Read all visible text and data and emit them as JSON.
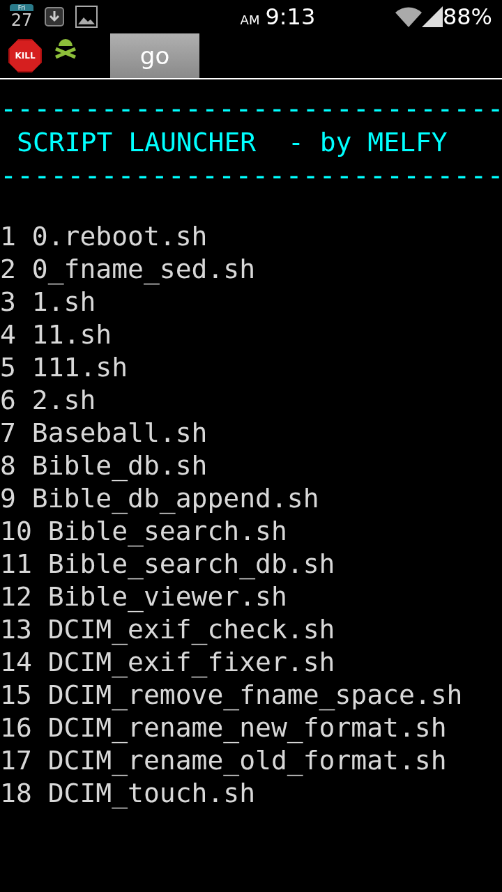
{
  "status_bar": {
    "calendar_day": "Fri",
    "calendar_date": "27",
    "am_pm": "AM",
    "time": "9:13",
    "battery": "88%"
  },
  "toolbar": {
    "kill_label": "KILL",
    "go_button": "go"
  },
  "terminal": {
    "rule_top": "------------------------------",
    "title": "SCRIPT LAUNCHER  - by MELFY",
    "rule_bottom": "------------------------------",
    "lines": [
      "1 0.reboot.sh",
      "2 0_fname_sed.sh",
      "3 1.sh",
      "4 11.sh",
      "5 111.sh",
      "6 2.sh",
      "7 Baseball.sh",
      "8 Bible_db.sh",
      "9 Bible_db_append.sh",
      "10 Bible_search.sh",
      "11 Bible_search_db.sh",
      "12 Bible_viewer.sh",
      "13 DCIM_exif_check.sh",
      "14 DCIM_exif_fixer.sh",
      "15 DCIM_remove_fname_space.sh",
      "16 DCIM_rename_new_format.sh",
      "17 DCIM_rename_old_format.sh",
      "18 DCIM_touch.sh"
    ]
  }
}
